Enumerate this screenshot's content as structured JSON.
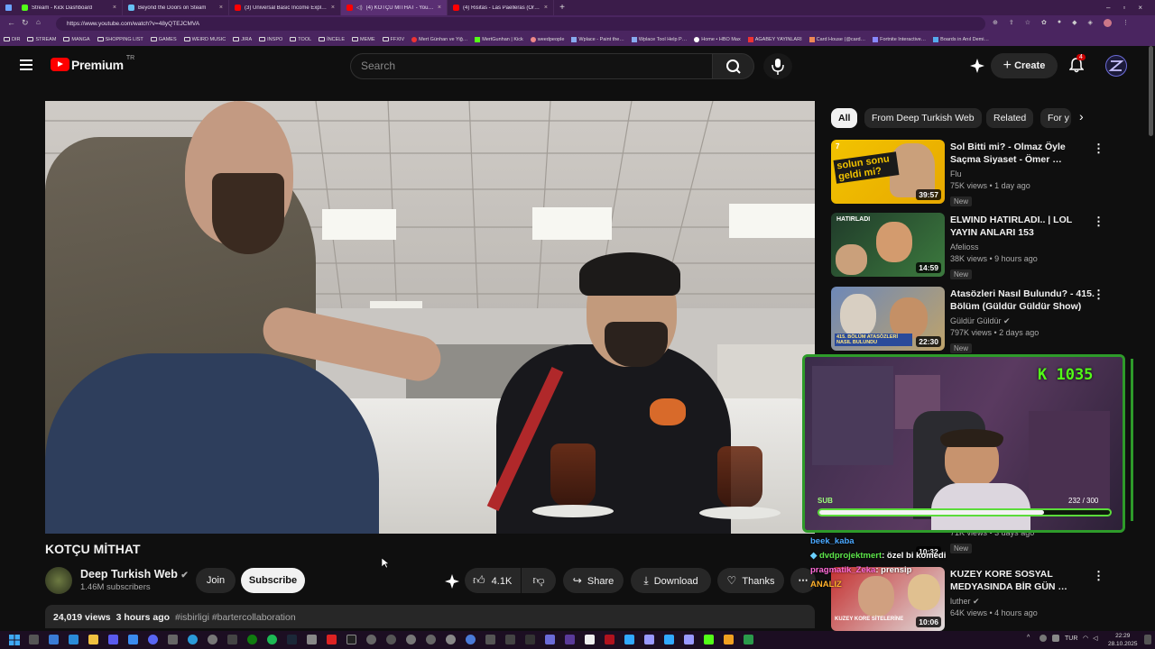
{
  "browser": {
    "tabs": [
      {
        "label": "Stream - Kick Dashboard",
        "color": "#53fc18"
      },
      {
        "label": "Beyond the Doors on Steam",
        "color": "#1b2838"
      },
      {
        "label": "(3) Universal Basic Income Explai…",
        "color": "#ff0000"
      },
      {
        "label": "(4) KOTÇU MİTHAT - YouTu…",
        "color": "#ff0000"
      },
      {
        "label": "(4) Risitas - Las Paelleras (Origina…",
        "color": "#ff0000"
      }
    ],
    "url": "https://www.youtube.com/watch?v=48yQTEJCMVA",
    "bookmarks": [
      "DIR",
      "STREAM",
      "MANGA",
      "SHOPPING LIST",
      "GAMES",
      "WEIRD MUSIC",
      "JIRA",
      "INSPO",
      "TOOL",
      "İNCELE",
      "MEME",
      "FFXIV",
      "Mert Günhan ve Yiğ…",
      "MertGunhan | Kick",
      "weedpeople",
      "Wplace - Paint the…",
      "Wplace Tool Help P…",
      "Home • HBO Max",
      "AGABEY YAYINLARI",
      "Card House (@card…",
      "Fortnite Interactive…",
      "Boards in Anıl Demi…"
    ]
  },
  "youtube": {
    "logo_text": "Premium",
    "logo_sup": "TR",
    "search_placeholder": "Search",
    "create_label": "Create",
    "notif_count": "4"
  },
  "video": {
    "title": "KOTÇU MİTHAT",
    "channel": "Deep Turkish Web",
    "subscribers": "1.46M subscribers",
    "join_label": "Join",
    "subscribe_label": "Subscribe",
    "likes": "4.1K",
    "share_label": "Share",
    "download_label": "Download",
    "thanks_label": "Thanks",
    "views": "24,019 views",
    "age": "3 hours ago",
    "hashtags": "#isbirligi #bartercollaboration"
  },
  "chips": [
    "All",
    "From Deep Turkish Web",
    "Related",
    "For y"
  ],
  "recommendations": [
    {
      "badge_num": "7",
      "title_line1": "Sol Bitti mi? - Olmaz Öyle",
      "title_line2": "Saçma Siyaset - Ömer …",
      "channel": "Flu",
      "meta": "75K views • 1 day ago",
      "new": "New",
      "duration": "39:57",
      "thumb_text": "solun sonu geldi mi?",
      "color": "#f2c300"
    },
    {
      "badge_num": "",
      "title_line1": "ELWIND HATIRLADI.. | LOL",
      "title_line2": "YAYIN ANLARI 153",
      "channel": "Afelioss",
      "meta": "38K views • 9 hours ago",
      "new": "New",
      "duration": "14:59",
      "thumb_text": "HATIRLADI",
      "color": "#2f6b3a"
    },
    {
      "badge_num": "",
      "title_line1": "Atasözleri Nasıl Bulundu? - 415.",
      "title_line2": "Bölüm (Güldür Güldür Show)",
      "channel": "Güldür Güldür",
      "meta": "797K views • 2 days ago",
      "new": "New",
      "duration": "22:30",
      "thumb_text": "415. BÖLÜM ATASÖZLERİ NASIL BULUNDU",
      "color": "#a07b3a"
    },
    {
      "badge_num": "",
      "title_line1": "KUZEY KORE SOSYAL",
      "title_line2": "MEDYASINDA BİR GÜN …",
      "channel": "luther",
      "meta": "64K views • 4 hours ago",
      "new": "New",
      "duration": "10:06",
      "thumb_text": "KUZEY KORE SİTELERİNE",
      "color": "#c43030"
    }
  ],
  "overlay": {
    "kick_label": "K 1035",
    "sub_label": "SUB",
    "sub_progress": "232 / 300",
    "sub_fraction": 0.773,
    "chat": [
      {
        "user": "beek_kaba",
        "text": ""
      },
      {
        "user": "dvdprojektmert",
        "text": ": özel bi komedi"
      },
      {
        "user": "pragmatik_Zeka",
        "text": ": prensip"
      },
      {
        "user": "ANALIZ",
        "text": ""
      }
    ],
    "partial_meta": "71K views • 3 days ago",
    "partial_new": "New",
    "partial_duration": "10:32"
  },
  "taskbar": {
    "lang": "TUR",
    "time": "22:29",
    "date": "28.10.2025"
  }
}
